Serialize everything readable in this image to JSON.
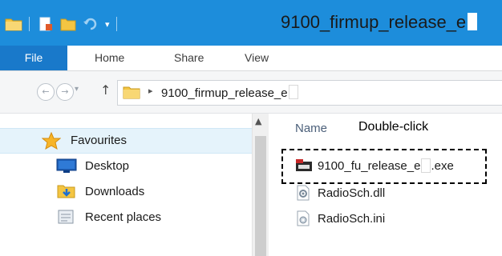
{
  "window": {
    "title": "9100_firmup_release_e"
  },
  "ribbon": {
    "tabs": [
      {
        "label": "File"
      },
      {
        "label": "Home"
      },
      {
        "label": "Share"
      },
      {
        "label": "View"
      }
    ]
  },
  "address": {
    "path_segment": "9100_firmup_release_e"
  },
  "navpane": {
    "favourites_label": "Favourites",
    "items": [
      {
        "label": "Desktop",
        "icon": "desktop-icon"
      },
      {
        "label": "Downloads",
        "icon": "downloads-folder-icon"
      },
      {
        "label": "Recent places",
        "icon": "recent-places-icon"
      }
    ]
  },
  "filelist": {
    "column_header": "Name",
    "annotation": "Double-click",
    "files": [
      {
        "name_prefix": "9100_fu_release_e",
        "name_suffix": ".exe",
        "icon": "installer-exe-icon"
      },
      {
        "name_prefix": "RadioSch.dll",
        "name_suffix": "",
        "icon": "dll-file-icon"
      },
      {
        "name_prefix": "RadioSch.ini",
        "name_suffix": "",
        "icon": "ini-file-icon"
      }
    ]
  },
  "colors": {
    "titlebar": "#1d8ddb",
    "file_tab": "#1979ca",
    "selection": "#e5f3fb"
  }
}
